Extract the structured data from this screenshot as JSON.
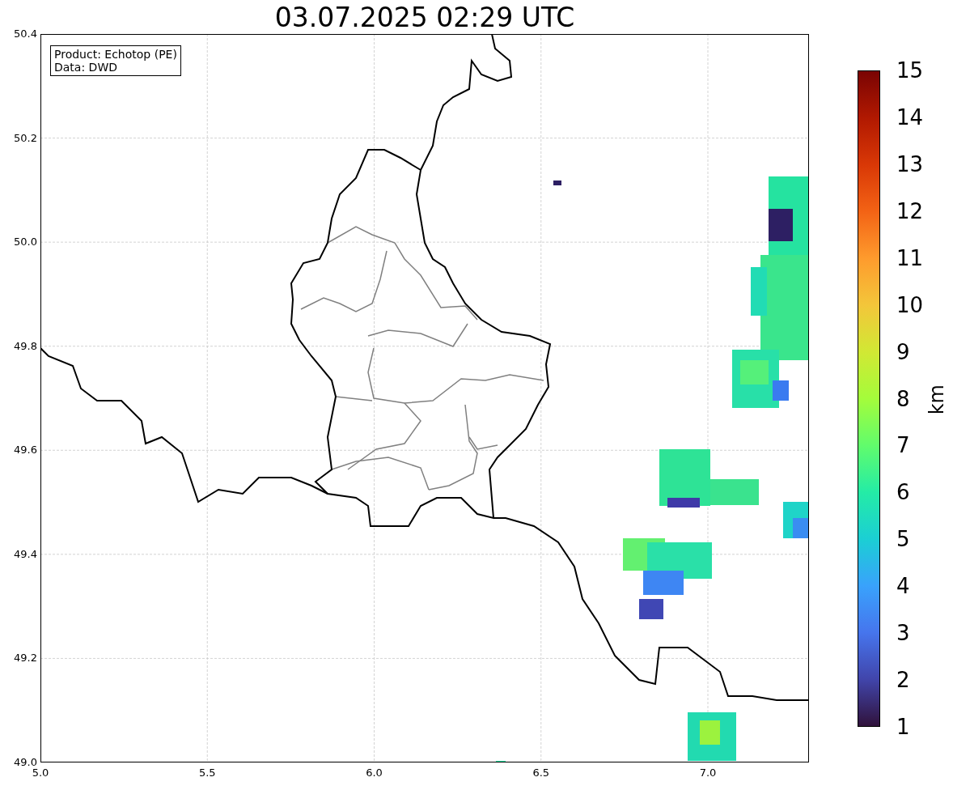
{
  "title": "03.07.2025 02:29 UTC",
  "info_box": {
    "lines": [
      "Product: Echotop (PE)",
      "Data: DWD"
    ]
  },
  "map": {
    "xticks": [
      "5.0",
      "5.5",
      "6.0",
      "6.5",
      "7.0"
    ],
    "yticks": [
      "50.4",
      "50.2",
      "50.0",
      "49.8",
      "49.6",
      "49.4",
      "49.2",
      "49.0"
    ]
  },
  "colorbar": {
    "label": "km",
    "ticks": [
      "15",
      "14",
      "13",
      "12",
      "11",
      "10",
      "9",
      "8",
      "7",
      "6",
      "5",
      "4",
      "3",
      "2",
      "1"
    ]
  }
}
